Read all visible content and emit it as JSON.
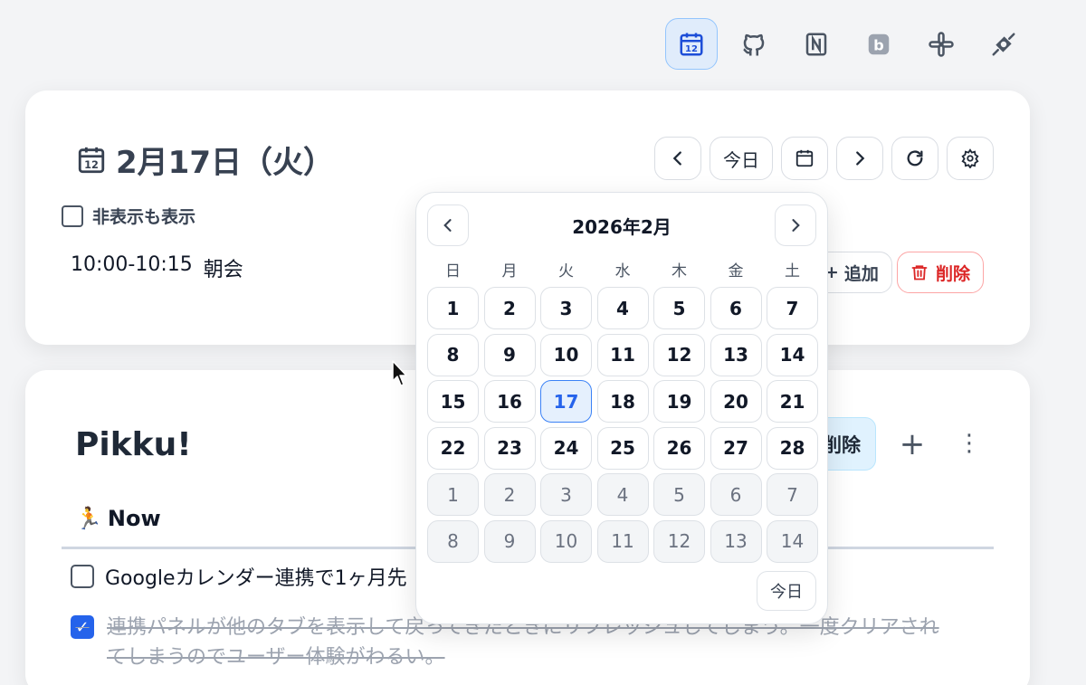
{
  "topbar": {
    "icons": [
      "calendar-icon",
      "github-icon",
      "notion-icon",
      "bookmark-b-icon",
      "slack-icon",
      "plugin-icon"
    ],
    "badge_letter": "b"
  },
  "date_card": {
    "title": "2月17日（火）",
    "today_label": "今日",
    "show_hidden_label": "非表示も表示",
    "event": {
      "time": "10:00-10:15",
      "title": "朝会"
    },
    "add_label": "追加",
    "delete_label": "削除"
  },
  "pikku_card": {
    "title": "Pikku!",
    "bulk_delete_label": "削除",
    "plus_label": "+",
    "more_label": "⋮",
    "section": {
      "emoji": "🏃",
      "label": "Now"
    },
    "todos": [
      {
        "text": "Googleカレンダー連携で1ヶ月先",
        "done": false
      },
      {
        "text": "連携パネルが他のタブを表示して戻ってきたときにリフレッシュしてしまう。一度クリアされてしまうのでユーザー体験がわるい。",
        "done": true
      }
    ]
  },
  "date_picker": {
    "title": "2026年2月",
    "weekdays": [
      "日",
      "月",
      "火",
      "水",
      "木",
      "金",
      "土"
    ],
    "days": [
      {
        "label": "1"
      },
      {
        "label": "2"
      },
      {
        "label": "3"
      },
      {
        "label": "4"
      },
      {
        "label": "5"
      },
      {
        "label": "6"
      },
      {
        "label": "7"
      },
      {
        "label": "8"
      },
      {
        "label": "9"
      },
      {
        "label": "10"
      },
      {
        "label": "11"
      },
      {
        "label": "12"
      },
      {
        "label": "13"
      },
      {
        "label": "14"
      },
      {
        "label": "15"
      },
      {
        "label": "16"
      },
      {
        "label": "17",
        "selected": true
      },
      {
        "label": "18"
      },
      {
        "label": "19"
      },
      {
        "label": "20"
      },
      {
        "label": "21"
      },
      {
        "label": "22"
      },
      {
        "label": "23"
      },
      {
        "label": "24"
      },
      {
        "label": "25"
      },
      {
        "label": "26"
      },
      {
        "label": "27"
      },
      {
        "label": "28"
      },
      {
        "label": "1",
        "other": true
      },
      {
        "label": "2",
        "other": true
      },
      {
        "label": "3",
        "other": true
      },
      {
        "label": "4",
        "other": true
      },
      {
        "label": "5",
        "other": true
      },
      {
        "label": "6",
        "other": true
      },
      {
        "label": "7",
        "other": true
      },
      {
        "label": "8",
        "other": true
      },
      {
        "label": "9",
        "other": true
      },
      {
        "label": "10",
        "other": true
      },
      {
        "label": "11",
        "other": true
      },
      {
        "label": "12",
        "other": true
      },
      {
        "label": "13",
        "other": true
      },
      {
        "label": "14",
        "other": true
      }
    ],
    "today_label": "今日"
  }
}
